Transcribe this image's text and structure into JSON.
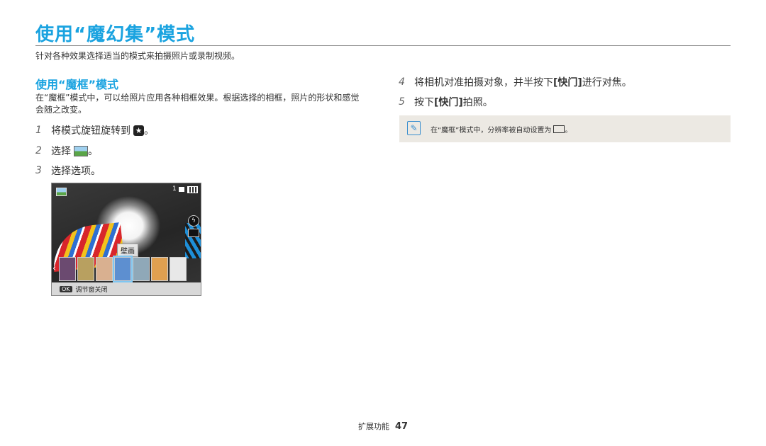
{
  "title": "使用“魔幻集”模式",
  "intro": "针对各种效果选择适当的模式来拍摄照片或录制视频。",
  "section": {
    "heading": "使用“魔框”模式",
    "description": "在“魔框”模式中，可以给照片应用各种相框效果。根据选择的相框，照片的形状和感觉会随之改变。"
  },
  "steps": [
    {
      "num": "1",
      "text": "将模式旋钮旋转到",
      "suffix": "。"
    },
    {
      "num": "2",
      "text": "选择",
      "suffix": "。"
    },
    {
      "num": "3",
      "text": "选择选项。"
    },
    {
      "num": "4",
      "text": "将相机对准拍摄对象，并半按下 ",
      "key": "[快门]",
      "suffix": " 进行对焦。"
    },
    {
      "num": "5",
      "text": "按下 ",
      "key": "[快门]",
      "suffix": " 拍照。"
    }
  ],
  "camera_screen": {
    "shot_count": "1",
    "frame_label": "壁画",
    "ok_key": "OK",
    "footer_text": "调节窗关闭"
  },
  "note": {
    "text": "在“魔框”模式中，分辨率被自动设置为",
    "suffix": "。"
  },
  "footer": {
    "section": "扩展功能",
    "page": "47"
  },
  "colors": {
    "accent": "#1aa3e0",
    "note_bg": "#ece9e3"
  },
  "icons": [
    "mode-dial-star-icon",
    "magic-frame-icon",
    "note-icon",
    "resolution-icon",
    "flash-icon",
    "battery-icon"
  ]
}
